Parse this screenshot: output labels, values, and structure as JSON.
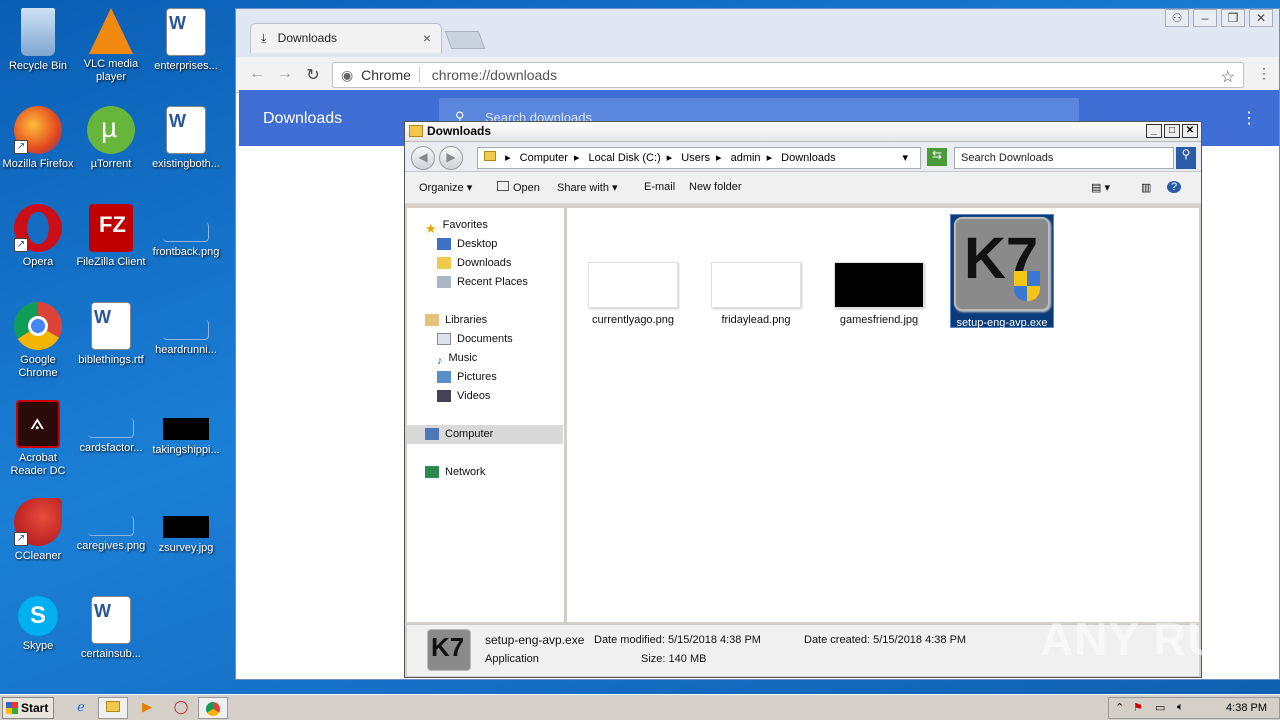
{
  "desktop": {
    "icons": [
      {
        "label": "Recycle Bin",
        "icon": "recycle-bin-icon"
      },
      {
        "label": "VLC media player",
        "icon": "vlc-icon"
      },
      {
        "label": "enterprises...",
        "icon": "word-doc-icon"
      },
      {
        "label": "Mozilla Firefox",
        "icon": "firefox-icon"
      },
      {
        "label": "µTorrent",
        "icon": "utorrent-icon"
      },
      {
        "label": "existingboth...",
        "icon": "word-doc-icon"
      },
      {
        "label": "Opera",
        "icon": "opera-icon"
      },
      {
        "label": "FileZilla Client",
        "icon": "filezilla-icon"
      },
      {
        "label": "frontback.png",
        "icon": "image-file-icon"
      },
      {
        "label": "Google Chrome",
        "icon": "chrome-icon"
      },
      {
        "label": "biblethings.rtf",
        "icon": "word-doc-icon"
      },
      {
        "label": "heardrunni...",
        "icon": "image-file-icon"
      },
      {
        "label": "Acrobat Reader DC",
        "icon": "acrobat-icon"
      },
      {
        "label": "cardsfactor...",
        "icon": "image-file-icon"
      },
      {
        "label": "takingshippi...",
        "icon": "image-file-icon"
      },
      {
        "label": "CCleaner",
        "icon": "ccleaner-icon"
      },
      {
        "label": "caregives.png",
        "icon": "image-file-icon"
      },
      {
        "label": "zsurvey.jpg",
        "icon": "image-file-icon"
      },
      {
        "label": "Skype",
        "icon": "skype-icon"
      },
      {
        "label": "certainsub...",
        "icon": "word-doc-icon"
      }
    ]
  },
  "chrome": {
    "tab_title": "Downloads",
    "omnibox_site": "Chrome",
    "omnibox_url": "chrome://downloads",
    "page_title": "Downloads",
    "search_placeholder": "Search downloads"
  },
  "explorer": {
    "title": "Downloads",
    "breadcrumb": [
      "Computer",
      "Local Disk (C:)",
      "Users",
      "admin",
      "Downloads"
    ],
    "search_placeholder": "Search Downloads",
    "commands": {
      "organize": "Organize",
      "open": "Open",
      "share": "Share with",
      "email": "E-mail",
      "new_folder": "New folder"
    },
    "nav": {
      "favorites": "Favorites",
      "desktop": "Desktop",
      "downloads": "Downloads",
      "recent": "Recent Places",
      "libraries": "Libraries",
      "documents": "Documents",
      "music": "Music",
      "pictures": "Pictures",
      "videos": "Videos",
      "computer": "Computer",
      "network": "Network"
    },
    "files": [
      {
        "name": "currentlyago.png",
        "thumb": "white"
      },
      {
        "name": "fridaylead.png",
        "thumb": "white"
      },
      {
        "name": "gamesfriend.jpg",
        "thumb": "black"
      },
      {
        "name": "setup-eng-avp.exe",
        "thumb": "k7"
      }
    ],
    "details": {
      "name": "setup-eng-avp.exe",
      "type": "Application",
      "modified_label": "Date modified:",
      "modified": "5/15/2018 4:38 PM",
      "created_label": "Date created:",
      "created": "5/15/2018 4:38 PM",
      "size_label": "Size:",
      "size": "140 MB"
    }
  },
  "taskbar": {
    "start": "Start",
    "clock": "4:38 PM"
  },
  "watermark": "ANY RUN"
}
